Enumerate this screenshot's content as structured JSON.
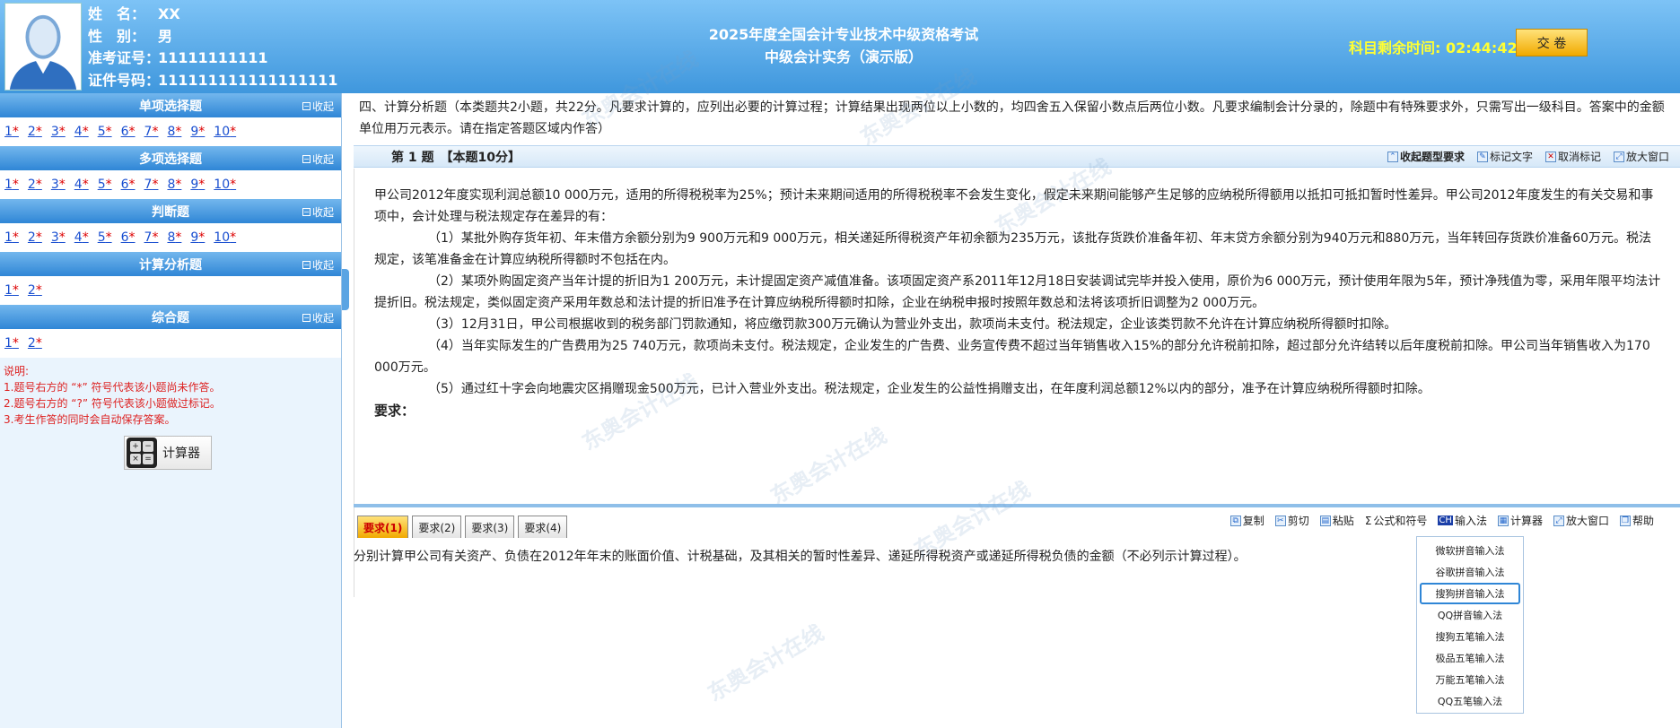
{
  "header": {
    "candidate": [
      {
        "label": "姓　名：",
        "value": "XX"
      },
      {
        "label": "性　别：",
        "value": "男"
      },
      {
        "label": "准考证号：",
        "value": "11111111111"
      },
      {
        "label": "证件号码：",
        "value": "111111111111111111"
      }
    ],
    "exam_title": "2025年度全国会计专业技术中级资格考试",
    "exam_subtitle": "中级会计实务（演示版）",
    "timer_label": "科目剩余时间:",
    "timer_value": "02:44:42",
    "submit_label": "交 卷"
  },
  "sidebar": {
    "collapse_label": "收起",
    "sections": [
      {
        "title": "单项选择题",
        "items": [
          "1",
          "2",
          "3",
          "4",
          "5",
          "6",
          "7",
          "8",
          "9",
          "10"
        ]
      },
      {
        "title": "多项选择题",
        "items": [
          "1",
          "2",
          "3",
          "4",
          "5",
          "6",
          "7",
          "8",
          "9",
          "10"
        ]
      },
      {
        "title": "判断题",
        "items": [
          "1",
          "2",
          "3",
          "4",
          "5",
          "6",
          "7",
          "8",
          "9",
          "10"
        ]
      },
      {
        "title": "计算分析题",
        "items": [
          "1",
          "2"
        ]
      },
      {
        "title": "综合题",
        "items": [
          "1",
          "2"
        ]
      }
    ],
    "star": "*",
    "notes": [
      "说明:",
      "1.题号右方的 “*” 符号代表该小题尚未作答。",
      "2.题号右方的 “?” 符号代表该小题做过标记。",
      "3.考生作答的同时会自动保存答案。"
    ],
    "calculator_label": "计算器"
  },
  "main": {
    "instructions": "四、计算分析题（本类题共2小题，共22分。凡要求计算的，应列出必要的计算过程；计算结果出现两位以上小数的，均四舍五入保留小数点后两位小数。凡要求编制会计分录的，除题中有特殊要求外，只需写出一级科目。答案中的金额单位用万元表示。请在指定答题区域内作答）",
    "question_number": "第 1 题　【本题10分】",
    "tools_top": [
      "收起题型要求",
      "标记文字",
      "取消标记",
      "放大窗口"
    ],
    "question_paragraphs": [
      "甲公司2012年度实现利润总额10 000万元，适用的所得税税率为25%；预计未来期间适用的所得税税率不会发生变化，假定未来期间能够产生足够的应纳税所得额用以抵扣可抵扣暂时性差异。甲公司2012年度发生的有关交易和事项中，会计处理与税法规定存在差异的有：",
      "（1）某批外购存货年初、年末借方余额分别为9 900万元和9 000万元，相关递延所得税资产年初余额为235万元，该批存货跌价准备年初、年末贷方余额分别为940万元和880万元，当年转回存货跌价准备60万元。税法规定，该笔准备金在计算应纳税所得额时不包括在内。",
      "（2）某项外购固定资产当年计提的折旧为1 200万元，未计提固定资产减值准备。该项固定资产系2011年12月18日安装调试完毕并投入使用，原价为6 000万元，预计使用年限为5年，预计净残值为零，采用年限平均法计提折旧。税法规定，类似固定资产采用年数总和法计提的折旧准予在计算应纳税所得额时扣除，企业在纳税申报时按照年数总和法将该项折旧调整为2 000万元。",
      "（3）12月31日，甲公司根据收到的税务部门罚款通知，将应缴罚款300万元确认为营业外支出，款项尚未支付。税法规定，企业该类罚款不允许在计算应纳税所得额时扣除。",
      "（4）当年实际发生的广告费用为25 740万元，款项尚未支付。税法规定，企业发生的广告费、业务宣传费不超过当年销售收入15%的部分允许税前扣除，超过部分允许结转以后年度税前扣除。甲公司当年销售收入为170 000万元。",
      "（5）通过红十字会向地震灾区捐赠现金500万元，已计入营业外支出。税法规定，企业发生的公益性捐赠支出，在年度利润总额12%以内的部分，准予在计算应纳税所得额时扣除。"
    ],
    "requirement_heading": "要求：",
    "tabs": [
      "要求(1)",
      "要求(2)",
      "要求(3)",
      "要求(4)"
    ],
    "tools_bottom": [
      "复制",
      "剪切",
      "粘贴",
      "公式和符号",
      "输入法",
      "计算器",
      "放大窗口",
      "帮助"
    ],
    "ime_badge": "CH",
    "requirement_text": "分别计算甲公司有关资产、负债在2012年年末的账面价值、计税基础，及其相关的暂时性差异、递延所得税资产或递延所得税负债的金额（不必列示计算过程）。",
    "ime_options": [
      "微软拼音输入法",
      "谷歌拼音输入法",
      "搜狗拼音输入法",
      "QQ拼音输入法",
      "搜狗五笔输入法",
      "极品五笔输入法",
      "万能五笔输入法",
      "QQ五笔输入法"
    ],
    "ime_selected_index": 2
  },
  "colors": {
    "header_top": "#7dc3f6",
    "header_bottom": "#3f97dd",
    "timer": "#ffff33",
    "link": "#1a4fd0",
    "star": "#dd0000",
    "note": "#dd2222"
  },
  "watermark": "东奥会计在线"
}
